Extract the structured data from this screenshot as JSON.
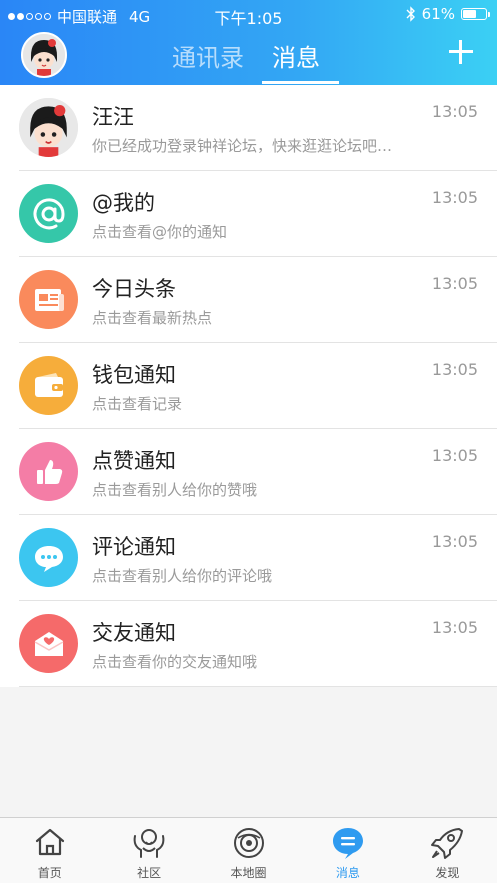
{
  "status_bar": {
    "carrier": "中国联通",
    "network": "4G",
    "time": "下午1:05",
    "battery": "61%",
    "battery_level": 0.61
  },
  "header": {
    "tabs": [
      {
        "label": "通讯录",
        "active": false
      },
      {
        "label": "消息",
        "active": true
      }
    ]
  },
  "messages": [
    {
      "title": "汪汪",
      "subtitle": "你已经成功登录钟祥论坛，快来逛逛论坛吧…",
      "time": "13:05",
      "icon": "avatar-girl",
      "color": "#e8e8e8"
    },
    {
      "title": "@我的",
      "subtitle": "点击查看@你的通知",
      "time": "13:05",
      "icon": "at-icon",
      "color": "#35c7a9"
    },
    {
      "title": "今日头条",
      "subtitle": "点击查看最新热点",
      "time": "13:05",
      "icon": "newspaper-icon",
      "color": "#fa8a5c"
    },
    {
      "title": "钱包通知",
      "subtitle": "点击查看记录",
      "time": "13:05",
      "icon": "wallet-icon",
      "color": "#f6ad3b"
    },
    {
      "title": "点赞通知",
      "subtitle": "点击查看别人给你的赞哦",
      "time": "13:05",
      "icon": "thumbs-up-icon",
      "color": "#f47da6"
    },
    {
      "title": "评论通知",
      "subtitle": "点击查看别人给你的评论哦",
      "time": "13:05",
      "icon": "comment-icon",
      "color": "#3cc6f0"
    },
    {
      "title": "交友通知",
      "subtitle": "点击查看你的交友通知哦",
      "time": "13:05",
      "icon": "envelope-heart-icon",
      "color": "#f56a6a"
    }
  ],
  "tabbar": [
    {
      "label": "首页",
      "icon": "home-icon",
      "active": false
    },
    {
      "label": "社区",
      "icon": "community-icon",
      "active": false
    },
    {
      "label": "本地圈",
      "icon": "local-circle-icon",
      "active": false
    },
    {
      "label": "消息",
      "icon": "message-icon",
      "active": true
    },
    {
      "label": "发现",
      "icon": "rocket-icon",
      "active": false
    }
  ],
  "colors": {
    "header_start": "#2a86f6",
    "header_end": "#3bd0f4",
    "accent": "#2f9bf0"
  }
}
